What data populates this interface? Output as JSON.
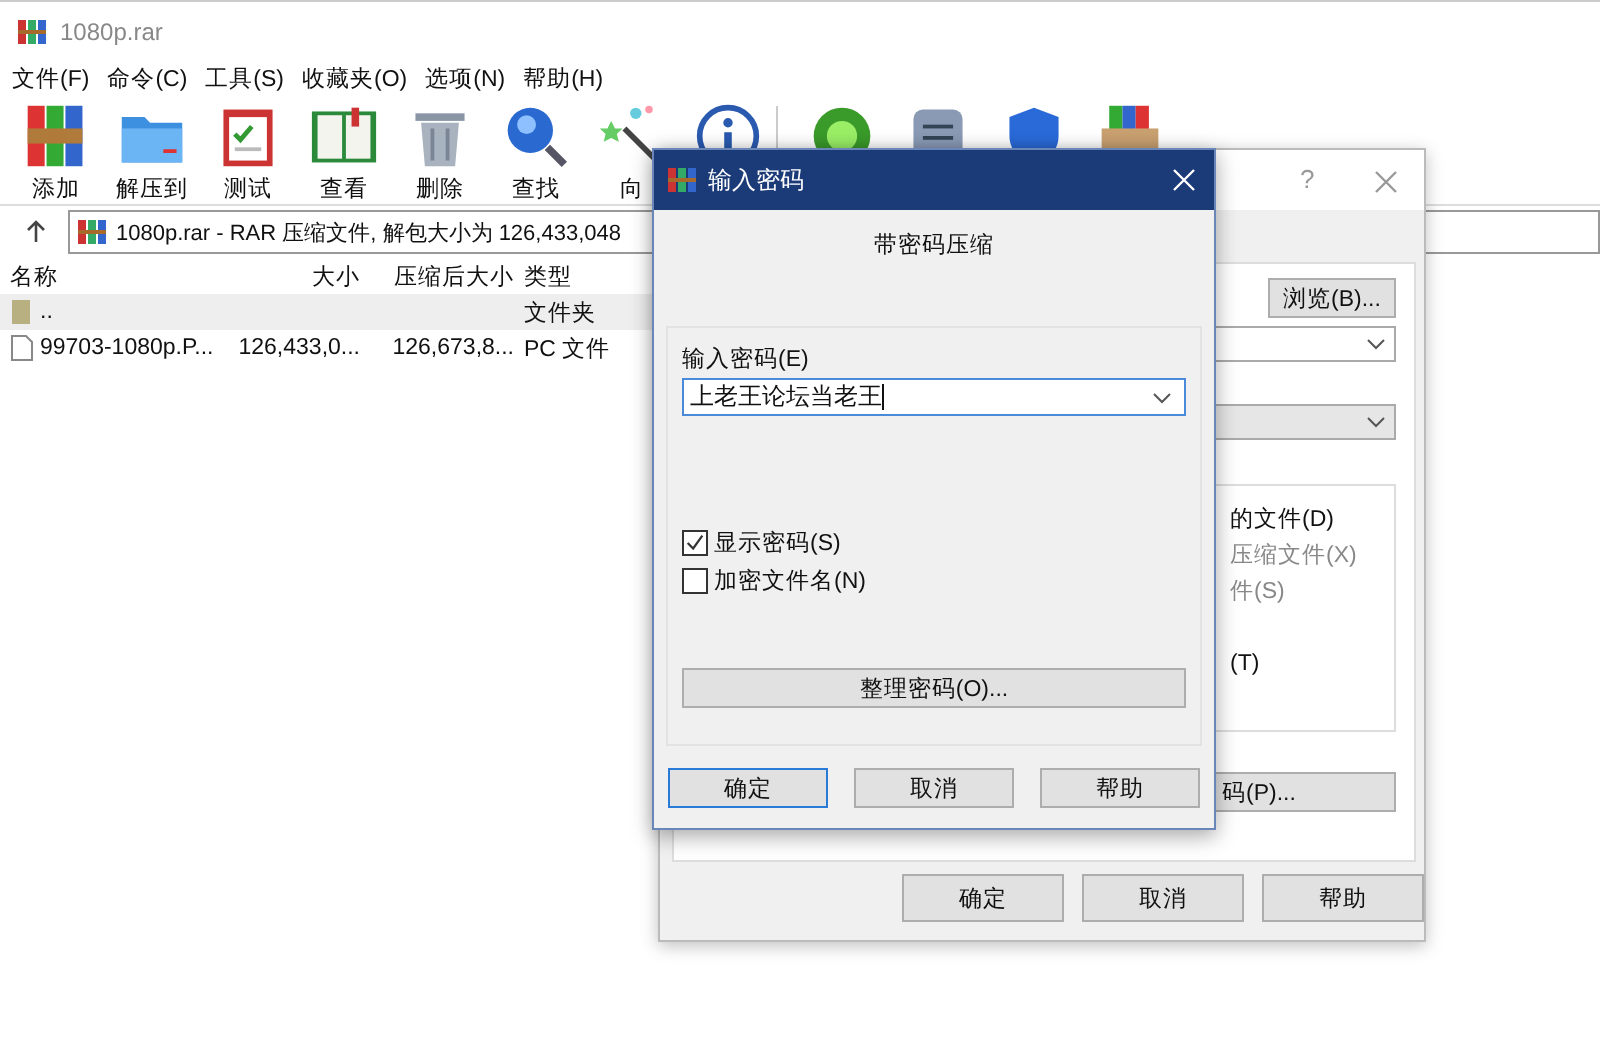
{
  "window": {
    "title": "1080p.rar"
  },
  "menu": [
    "文件(F)",
    "命令(C)",
    "工具(S)",
    "收藏夹(O)",
    "选项(N)",
    "帮助(H)"
  ],
  "toolbar": [
    {
      "kind": "books",
      "label": "添加"
    },
    {
      "kind": "folder",
      "label": "解压到"
    },
    {
      "kind": "clipboard",
      "label": "测试"
    },
    {
      "kind": "book",
      "label": "查看"
    },
    {
      "kind": "trash",
      "label": "删除"
    },
    {
      "kind": "magnifier",
      "label": "查找"
    },
    {
      "kind": "wand",
      "label": "向"
    },
    {
      "kind": "info"
    },
    {
      "kind": "separator"
    },
    {
      "kind": "bug"
    },
    {
      "kind": "document"
    },
    {
      "kind": "shield"
    },
    {
      "kind": "box"
    }
  ],
  "address": {
    "text": "1080p.rar - RAR 压缩文件, 解包大小为 126,433,048"
  },
  "table": {
    "columns": [
      "名称",
      "大小",
      "压缩后大小",
      "类型"
    ],
    "rows": [
      {
        "kind": "folder",
        "name": "..",
        "size": "",
        "packed": "",
        "type": "文件夹",
        "selected": true
      },
      {
        "kind": "file",
        "name": "99703-1080p.P...",
        "size": "126,433,0...",
        "packed": "126,673,8...",
        "type": "PC 文件",
        "selected": false
      }
    ]
  },
  "archive_dialog": {
    "help": "?",
    "browse_button": "浏览(B)...",
    "options": [
      {
        "label": "的文件(D)",
        "disabled": false
      },
      {
        "label": "压缩文件(X)",
        "disabled": true
      },
      {
        "label": "件(S)",
        "disabled": true
      },
      {
        "label": "(T)",
        "disabled": false
      }
    ],
    "password_button": "码(P)...",
    "buttons": [
      "确定",
      "取消",
      "帮助"
    ]
  },
  "password_dialog": {
    "title": "输入密码",
    "heading": "带密码压缩",
    "field_label": "输入密码(E)",
    "value": "上老王论坛当老王",
    "checkboxes": [
      {
        "label": "显示密码(S)",
        "checked": true
      },
      {
        "label": "加密文件名(N)",
        "checked": false
      }
    ],
    "organize_button": "整理密码(O)...",
    "buttons": [
      {
        "label": "确定",
        "default": true
      },
      {
        "label": "取消",
        "default": false
      },
      {
        "label": "帮助",
        "default": false
      }
    ]
  }
}
